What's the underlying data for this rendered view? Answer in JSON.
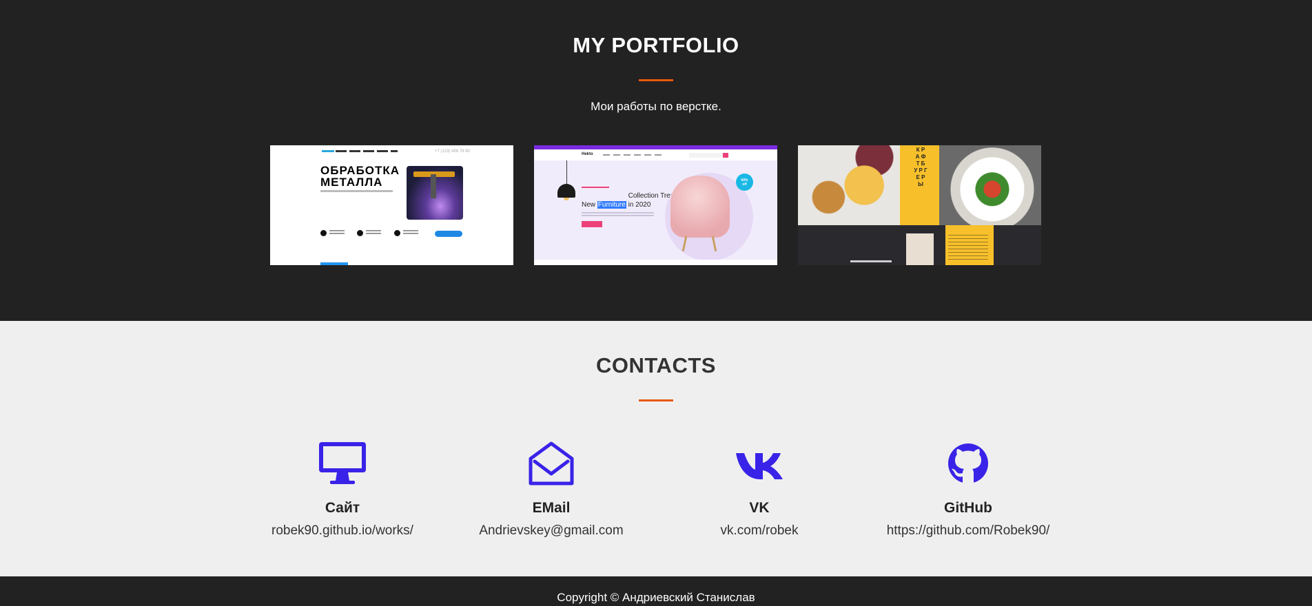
{
  "portfolio": {
    "title": "MY PORTFOLIO",
    "subtitle": "Мои работы по верстке.",
    "items": [
      {
        "heading": "ОБРАБОТКА МЕТАЛЛА"
      },
      {
        "brand": "Hekto",
        "heading_pre": "New",
        "heading_highlight": "Furniture",
        "heading_post": "Collection Trends in 2020"
      },
      {
        "side_letters": "К Р А Ф Т Б У Р Г Е Р Ы"
      }
    ]
  },
  "contacts": {
    "title": "CONTACTS",
    "items": [
      {
        "icon": "monitor-icon",
        "title": "Сайт",
        "value": "robek90.github.io/works/"
      },
      {
        "icon": "envelope-open-icon",
        "title": "EMail",
        "value": "Andrievskey@gmail.com"
      },
      {
        "icon": "vk-icon",
        "title": "VK",
        "value": "vk.com/robek"
      },
      {
        "icon": "github-icon",
        "title": "GitHub",
        "value": "https://github.com/Robek90/"
      }
    ]
  },
  "footer": {
    "copyright": "Copyright © Андриевский Станислав"
  },
  "colors": {
    "dark_bg": "#222222",
    "light_bg": "#efefef",
    "accent": "#e8590c",
    "icon": "#3a23e8"
  }
}
